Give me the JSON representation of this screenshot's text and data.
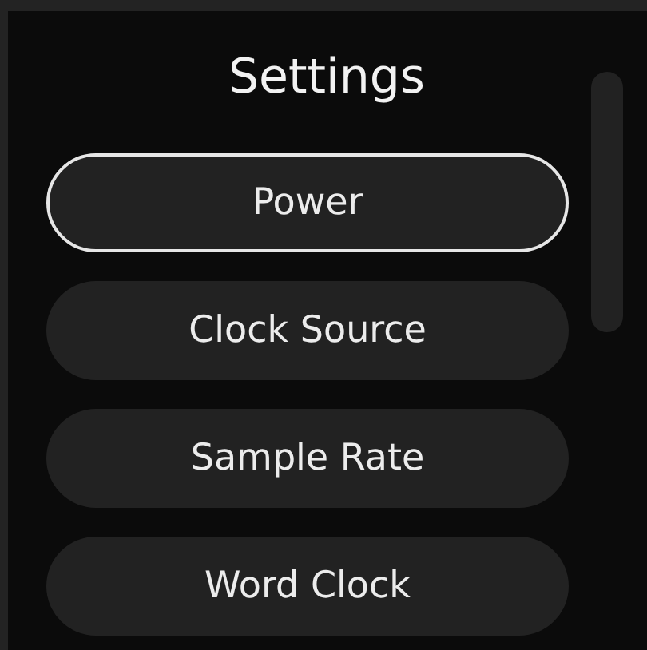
{
  "title": "Settings",
  "items": [
    {
      "label": "Power",
      "selected": true
    },
    {
      "label": "Clock Source",
      "selected": false
    },
    {
      "label": "Sample Rate",
      "selected": false
    },
    {
      "label": "Word Clock",
      "selected": false
    }
  ]
}
